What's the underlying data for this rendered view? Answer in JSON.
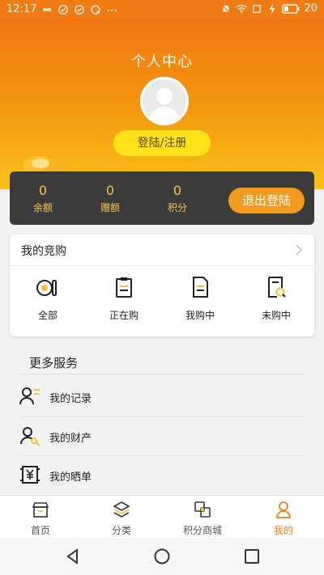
{
  "status_bar": {
    "time": "12:17",
    "battery": "20"
  },
  "header": {
    "title": "个人中心",
    "login_label": "登陆/注册"
  },
  "stats": [
    {
      "value": "0",
      "label": "余额"
    },
    {
      "value": "0",
      "label": "赠额"
    },
    {
      "value": "0",
      "label": "积分"
    }
  ],
  "logout_label": "退出登陆",
  "auction": {
    "title": "我的竞购",
    "items": [
      {
        "label": "全部",
        "icon": "all-icon"
      },
      {
        "label": "正在购",
        "icon": "clipboard-icon"
      },
      {
        "label": "我购中",
        "icon": "document-icon"
      },
      {
        "label": "未购中",
        "icon": "search-document-icon"
      }
    ]
  },
  "more_services": {
    "title": "更多服务",
    "items": [
      {
        "label": "我的记录",
        "icon": "user-list-icon"
      },
      {
        "label": "我的财产",
        "icon": "user-key-icon"
      },
      {
        "label": "我的晒单",
        "icon": "yen-receipt-icon"
      }
    ]
  },
  "tabs": [
    {
      "label": "首页",
      "icon": "shop-icon",
      "active": false
    },
    {
      "label": "分类",
      "icon": "layers-icon",
      "active": false
    },
    {
      "label": "积分商城",
      "icon": "exchange-icon",
      "active": false
    },
    {
      "label": "我的",
      "icon": "user-icon",
      "active": true
    }
  ],
  "colors": {
    "orange": "#f07b12",
    "gold": "#f6c643",
    "yellow": "#ffe21a",
    "dark": "#3b3b3b"
  }
}
